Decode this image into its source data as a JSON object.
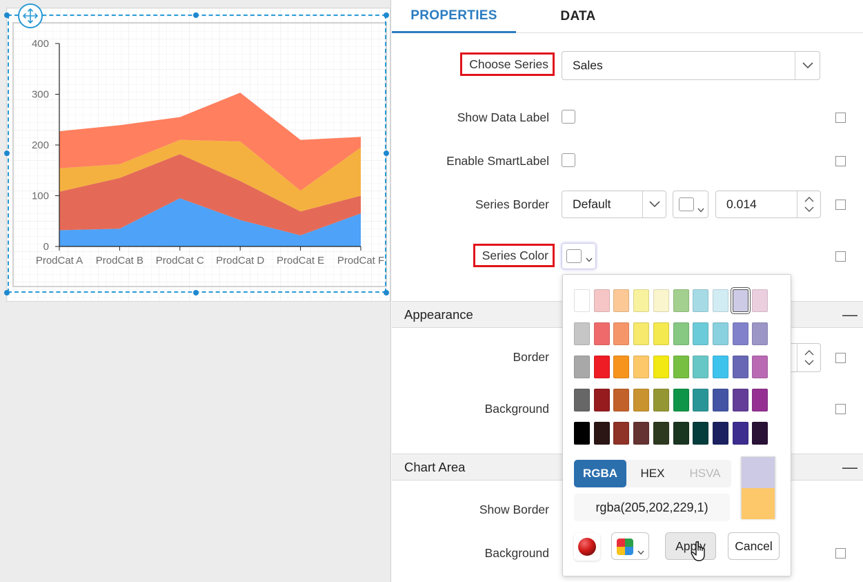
{
  "tabs": {
    "properties": "PROPERTIES",
    "data": "DATA"
  },
  "properties": {
    "choose_series_label": "Choose Series",
    "choose_series_value": "Sales",
    "show_data_label": "Show Data Label",
    "enable_smart_label": "Enable SmartLabel",
    "series_border_label": "Series Border",
    "series_border_style": "Default",
    "series_border_width": "0.014",
    "series_color_label": "Series Color"
  },
  "sections": {
    "appearance": {
      "title": "Appearance",
      "border_label": "Border",
      "background_label": "Background",
      "collapse": "—"
    },
    "chart_area": {
      "title": "Chart Area",
      "show_border_label": "Show Border",
      "background_label": "Background",
      "collapse": "—"
    }
  },
  "color_picker": {
    "palette": [
      [
        "#ffffff",
        "#f6c6c6",
        "#fcc996",
        "#f8f29f",
        "#faf5cc",
        "#a3d08f",
        "#a6dbe6",
        "#d1ecf2",
        "#cdcae5",
        "#eccfdf"
      ],
      [
        "#c6c6c6",
        "#ef6b6b",
        "#f5966a",
        "#f6e96b",
        "#f4e94f",
        "#87c882",
        "#6ccbd8",
        "#89d1df",
        "#8181cb",
        "#9b96c6"
      ],
      [
        "#a8a8a8",
        "#ee1c24",
        "#f7941d",
        "#fdc86a",
        "#f2e812",
        "#76bf43",
        "#67c7c6",
        "#3ec3ed",
        "#6767b5",
        "#b96ab3"
      ],
      [
        "#676767",
        "#951b1e",
        "#c2612a",
        "#c9942f",
        "#949634",
        "#0f9547",
        "#2a9597",
        "#4454a4",
        "#633d97",
        "#953092"
      ],
      [
        "#000000",
        "#2b1515",
        "#8f3227",
        "#653332",
        "#2e3a1f",
        "#1a3520",
        "#053d3c",
        "#1b2160",
        "#3c2d8f",
        "#2a1136"
      ]
    ],
    "selected_swatch": "#cdcae5",
    "modes": [
      "RGBA",
      "HEX",
      "HSVA"
    ],
    "active_mode": "RGBA",
    "value": "rgba(205,202,229,1)",
    "preview_new": "#cdcae5",
    "preview_old": "#fdc86a",
    "apply_label": "Apply",
    "cancel_label": "Cancel"
  },
  "chart_data": {
    "type": "area",
    "stacked": true,
    "categories": [
      "ProdCat A",
      "ProdCat B",
      "ProdCat C",
      "ProdCat D",
      "ProdCat E",
      "ProdCat F"
    ],
    "yticks": [
      0,
      100,
      200,
      300,
      400
    ],
    "ylim": [
      0,
      400
    ],
    "grid": false,
    "colors": [
      "#4ea2f7",
      "#e46a57",
      "#f4b13f",
      "#ff7f5e"
    ],
    "series": [
      {
        "values": [
          32,
          35,
          95,
          52,
          22,
          65
        ]
      },
      {
        "values": [
          76,
          100,
          87,
          77,
          47,
          35
        ]
      },
      {
        "values": [
          46,
          27,
          28,
          78,
          41,
          95
        ]
      },
      {
        "values": [
          73,
          77,
          45,
          96,
          100,
          21
        ]
      }
    ]
  }
}
